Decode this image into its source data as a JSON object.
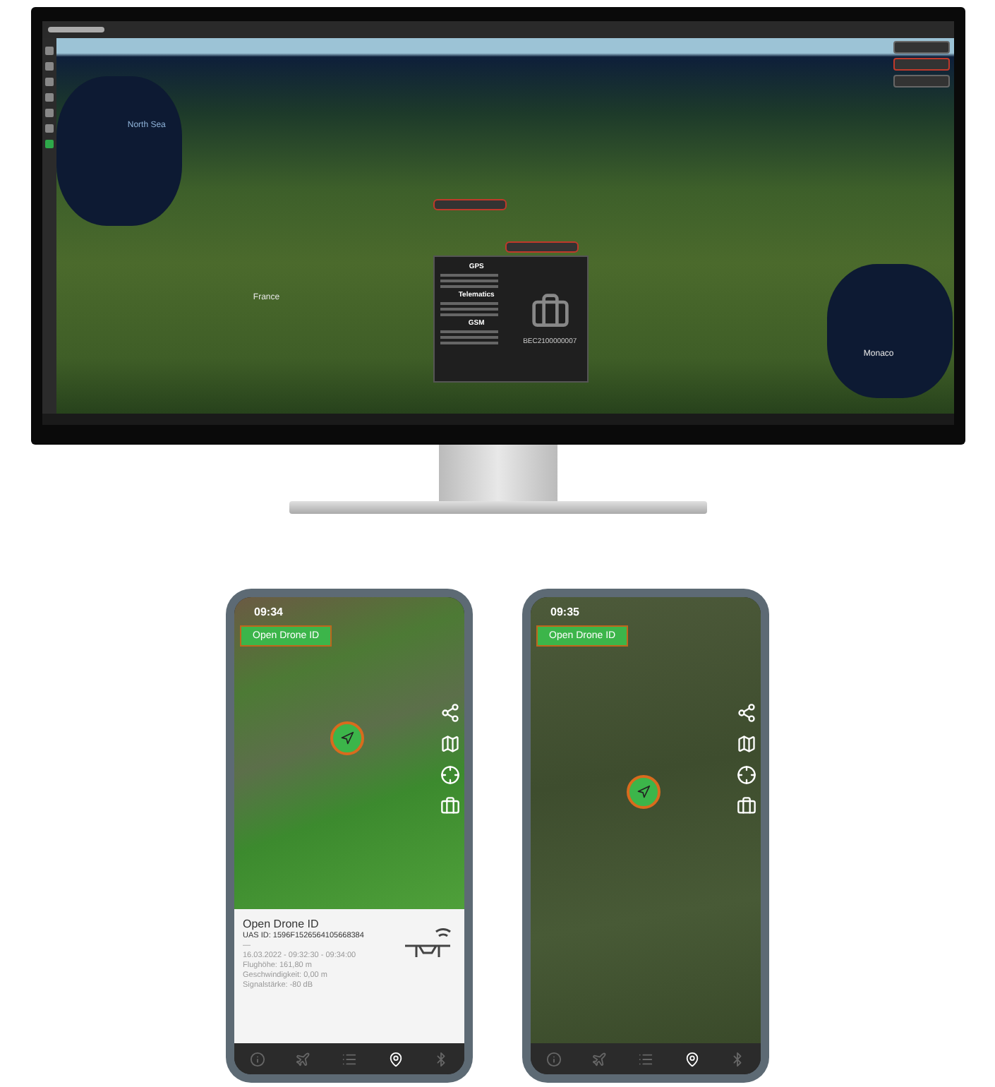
{
  "monitor": {
    "map_labels": [
      {
        "text": "North Sea",
        "kind": "sea"
      },
      {
        "text": "France",
        "kind": "land"
      },
      {
        "text": "Monaco",
        "kind": "land"
      }
    ],
    "popup": {
      "sections": [
        "GPS",
        "Telematics",
        "GSM"
      ],
      "device_id": "BEC2100000007"
    }
  },
  "phones": [
    {
      "time": "09:34",
      "badge": "Open Drone ID",
      "kind": "aerial",
      "card": {
        "title": "Open Drone ID",
        "uas_id": "UAS ID: 1596F1526564105668384",
        "lines": [
          "—",
          "16.03.2022 - 09:32:30 - 09:34:00",
          "Flughöhe: 161,80 m",
          "Geschwindigkeit: 0,00 m",
          "Signalstärke: -80 dB"
        ]
      },
      "tabs": [
        {
          "selected": false
        },
        {
          "selected": false
        },
        {
          "selected": false
        },
        {
          "selected": true
        },
        {
          "selected": false
        }
      ]
    },
    {
      "time": "09:35",
      "badge": "Open Drone ID",
      "kind": "satellite",
      "tabs": [
        {
          "selected": false
        },
        {
          "selected": false
        },
        {
          "selected": false
        },
        {
          "selected": true
        },
        {
          "selected": false
        }
      ]
    }
  ]
}
